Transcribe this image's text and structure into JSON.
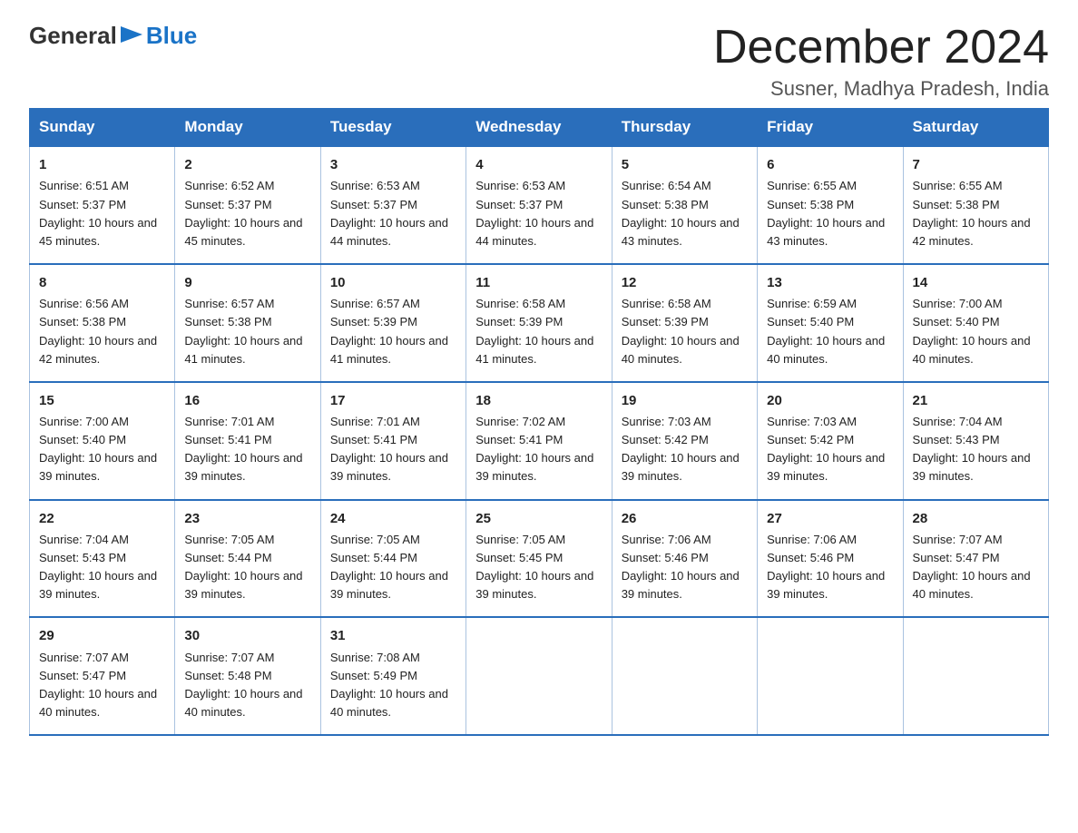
{
  "header": {
    "logo_general": "General",
    "logo_blue": "Blue",
    "month_title": "December 2024",
    "location": "Susner, Madhya Pradesh, India"
  },
  "days_of_week": [
    "Sunday",
    "Monday",
    "Tuesday",
    "Wednesday",
    "Thursday",
    "Friday",
    "Saturday"
  ],
  "weeks": [
    [
      {
        "num": "1",
        "sunrise": "6:51 AM",
        "sunset": "5:37 PM",
        "daylight": "10 hours and 45 minutes."
      },
      {
        "num": "2",
        "sunrise": "6:52 AM",
        "sunset": "5:37 PM",
        "daylight": "10 hours and 45 minutes."
      },
      {
        "num": "3",
        "sunrise": "6:53 AM",
        "sunset": "5:37 PM",
        "daylight": "10 hours and 44 minutes."
      },
      {
        "num": "4",
        "sunrise": "6:53 AM",
        "sunset": "5:37 PM",
        "daylight": "10 hours and 44 minutes."
      },
      {
        "num": "5",
        "sunrise": "6:54 AM",
        "sunset": "5:38 PM",
        "daylight": "10 hours and 43 minutes."
      },
      {
        "num": "6",
        "sunrise": "6:55 AM",
        "sunset": "5:38 PM",
        "daylight": "10 hours and 43 minutes."
      },
      {
        "num": "7",
        "sunrise": "6:55 AM",
        "sunset": "5:38 PM",
        "daylight": "10 hours and 42 minutes."
      }
    ],
    [
      {
        "num": "8",
        "sunrise": "6:56 AM",
        "sunset": "5:38 PM",
        "daylight": "10 hours and 42 minutes."
      },
      {
        "num": "9",
        "sunrise": "6:57 AM",
        "sunset": "5:38 PM",
        "daylight": "10 hours and 41 minutes."
      },
      {
        "num": "10",
        "sunrise": "6:57 AM",
        "sunset": "5:39 PM",
        "daylight": "10 hours and 41 minutes."
      },
      {
        "num": "11",
        "sunrise": "6:58 AM",
        "sunset": "5:39 PM",
        "daylight": "10 hours and 41 minutes."
      },
      {
        "num": "12",
        "sunrise": "6:58 AM",
        "sunset": "5:39 PM",
        "daylight": "10 hours and 40 minutes."
      },
      {
        "num": "13",
        "sunrise": "6:59 AM",
        "sunset": "5:40 PM",
        "daylight": "10 hours and 40 minutes."
      },
      {
        "num": "14",
        "sunrise": "7:00 AM",
        "sunset": "5:40 PM",
        "daylight": "10 hours and 40 minutes."
      }
    ],
    [
      {
        "num": "15",
        "sunrise": "7:00 AM",
        "sunset": "5:40 PM",
        "daylight": "10 hours and 39 minutes."
      },
      {
        "num": "16",
        "sunrise": "7:01 AM",
        "sunset": "5:41 PM",
        "daylight": "10 hours and 39 minutes."
      },
      {
        "num": "17",
        "sunrise": "7:01 AM",
        "sunset": "5:41 PM",
        "daylight": "10 hours and 39 minutes."
      },
      {
        "num": "18",
        "sunrise": "7:02 AM",
        "sunset": "5:41 PM",
        "daylight": "10 hours and 39 minutes."
      },
      {
        "num": "19",
        "sunrise": "7:03 AM",
        "sunset": "5:42 PM",
        "daylight": "10 hours and 39 minutes."
      },
      {
        "num": "20",
        "sunrise": "7:03 AM",
        "sunset": "5:42 PM",
        "daylight": "10 hours and 39 minutes."
      },
      {
        "num": "21",
        "sunrise": "7:04 AM",
        "sunset": "5:43 PM",
        "daylight": "10 hours and 39 minutes."
      }
    ],
    [
      {
        "num": "22",
        "sunrise": "7:04 AM",
        "sunset": "5:43 PM",
        "daylight": "10 hours and 39 minutes."
      },
      {
        "num": "23",
        "sunrise": "7:05 AM",
        "sunset": "5:44 PM",
        "daylight": "10 hours and 39 minutes."
      },
      {
        "num": "24",
        "sunrise": "7:05 AM",
        "sunset": "5:44 PM",
        "daylight": "10 hours and 39 minutes."
      },
      {
        "num": "25",
        "sunrise": "7:05 AM",
        "sunset": "5:45 PM",
        "daylight": "10 hours and 39 minutes."
      },
      {
        "num": "26",
        "sunrise": "7:06 AM",
        "sunset": "5:46 PM",
        "daylight": "10 hours and 39 minutes."
      },
      {
        "num": "27",
        "sunrise": "7:06 AM",
        "sunset": "5:46 PM",
        "daylight": "10 hours and 39 minutes."
      },
      {
        "num": "28",
        "sunrise": "7:07 AM",
        "sunset": "5:47 PM",
        "daylight": "10 hours and 40 minutes."
      }
    ],
    [
      {
        "num": "29",
        "sunrise": "7:07 AM",
        "sunset": "5:47 PM",
        "daylight": "10 hours and 40 minutes."
      },
      {
        "num": "30",
        "sunrise": "7:07 AM",
        "sunset": "5:48 PM",
        "daylight": "10 hours and 40 minutes."
      },
      {
        "num": "31",
        "sunrise": "7:08 AM",
        "sunset": "5:49 PM",
        "daylight": "10 hours and 40 minutes."
      },
      null,
      null,
      null,
      null
    ]
  ]
}
